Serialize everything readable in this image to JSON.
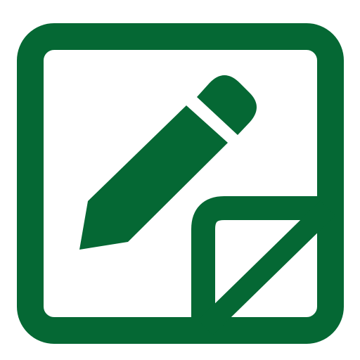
{
  "icon": {
    "name": "edit-note-icon",
    "color": "#056834",
    "background": "#ffffff"
  }
}
